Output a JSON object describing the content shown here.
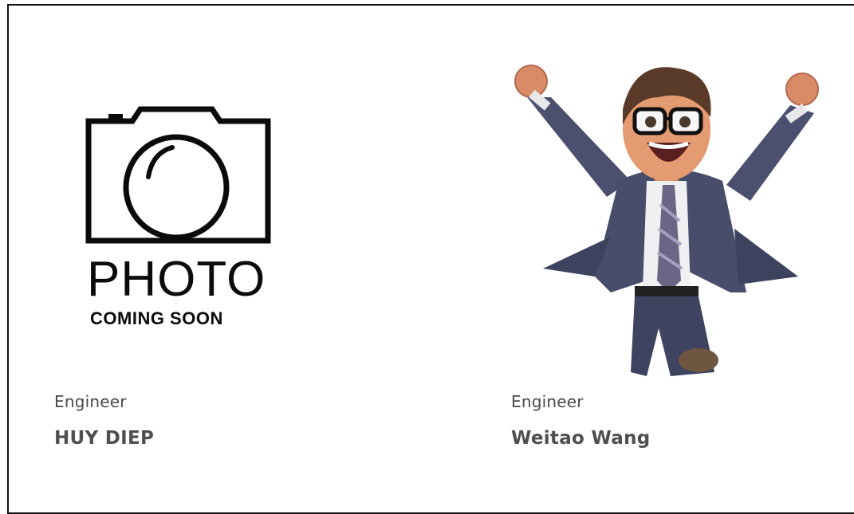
{
  "team": {
    "members": [
      {
        "role": "Engineer",
        "name": "HUY DIEP",
        "photo_placeholder": {
          "line1": "PHOTO",
          "line2": "COMING SOON",
          "icon": "camera-icon"
        }
      },
      {
        "role": "Engineer",
        "name": "Weitao Wang",
        "photo_icon": "cartoon-businessman-jumping"
      }
    ]
  }
}
